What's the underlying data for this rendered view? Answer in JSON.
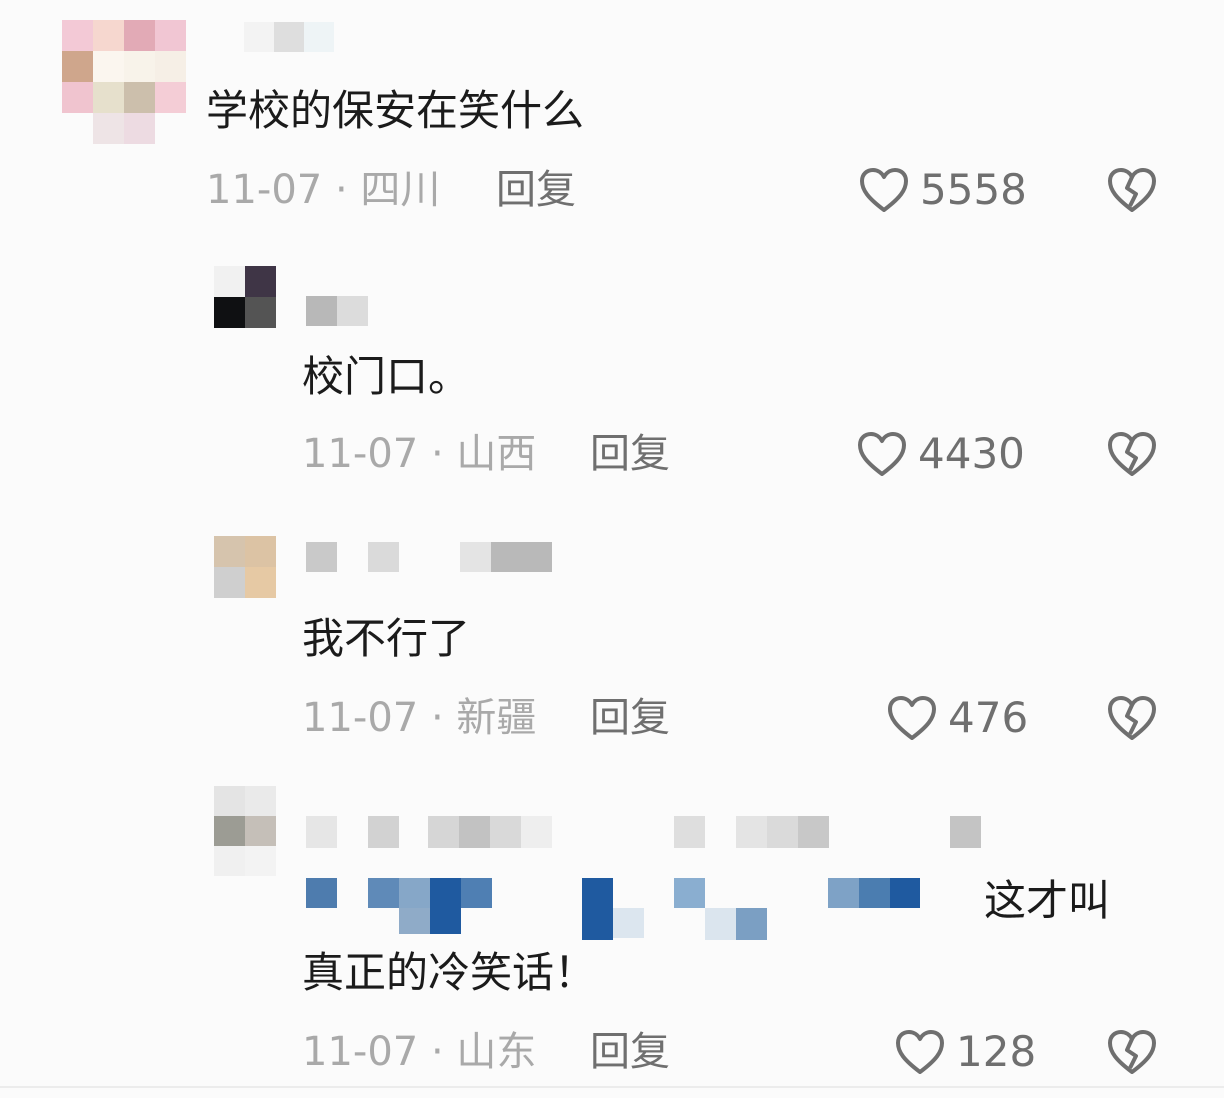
{
  "comments": [
    {
      "text": "学校的保安在笑什么",
      "date": "11-07",
      "location": "四川",
      "reply_label": "回复",
      "likes": "5558"
    },
    {
      "text": "校门口。",
      "date": "11-07",
      "location": "山西",
      "reply_label": "回复",
      "likes": "4430"
    },
    {
      "text": "我不行了",
      "date": "11-07",
      "location": "新疆",
      "reply_label": "回复",
      "likes": "476"
    },
    {
      "text_line1_tail": "这才叫",
      "text_line2": "真正的冷笑话！",
      "date": "11-07",
      "location": "山东",
      "reply_label": "回复",
      "likes": "128"
    }
  ],
  "meta_separator": "·",
  "icons": {
    "like": "heart-outline-icon",
    "dislike": "broken-heart-icon"
  },
  "colors": {
    "text": "#1b1b1b",
    "meta": "#a9a9a9",
    "action": "#6f6f6f",
    "mention_blue": "#1f5aa0"
  }
}
